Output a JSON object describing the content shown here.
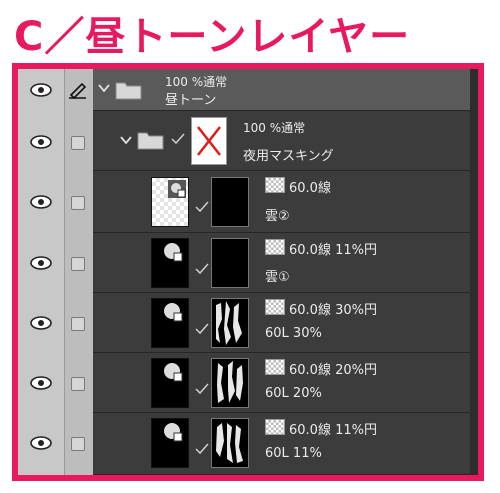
{
  "heading": "C／昼トーンレイヤー",
  "colors": {
    "accent": "#e8195f",
    "panel_bg": "#3c3c3c",
    "sidebar_bg": "#c8c8c8"
  },
  "folder_top": {
    "mode": "100 %通常",
    "name": "昼トーン"
  },
  "folder_mask": {
    "mode": "100 %通常",
    "name": "夜用マスキング"
  },
  "layers": [
    {
      "mode": "60.0線",
      "name": "雲②"
    },
    {
      "mode": "60.0線 11%円",
      "name": "雲①"
    },
    {
      "mode": "60.0線 30%円",
      "name": "60L 30%"
    },
    {
      "mode": "60.0線 20%円",
      "name": "60L 20%"
    },
    {
      "mode": "60.0線 11%円",
      "name": "60L 11%"
    }
  ]
}
